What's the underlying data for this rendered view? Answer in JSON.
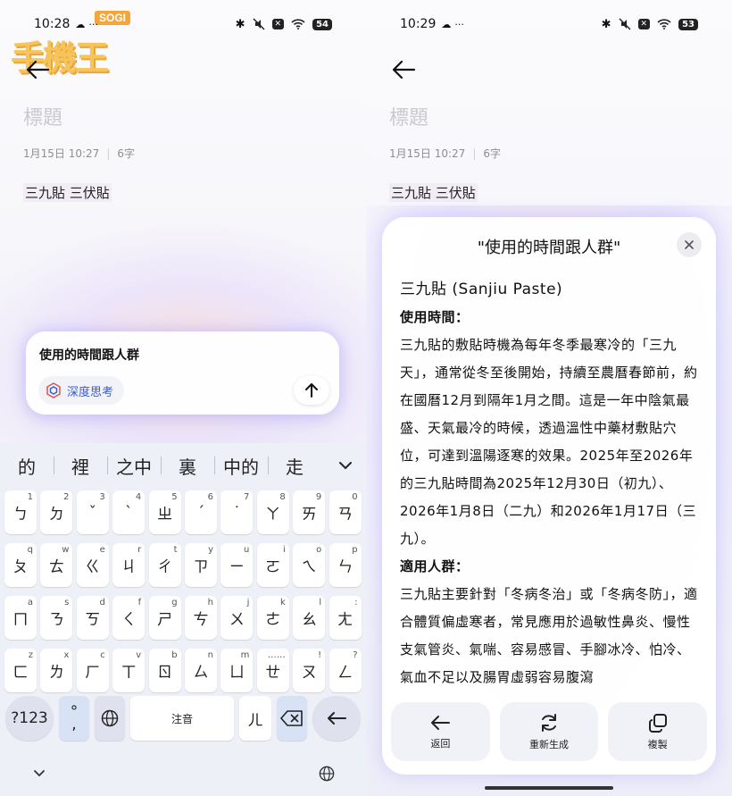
{
  "left": {
    "status": {
      "time": "10:28",
      "cloud": "☁",
      "dots": "···",
      "bluetooth": "✱",
      "x_badge": "✕",
      "wifi": "◠",
      "battery": "54"
    },
    "watermark": {
      "brand": "SOGI",
      "mark": "手機王"
    },
    "note": {
      "title_placeholder": "標題",
      "date": "1月15日 10:27",
      "separator": "|",
      "word_count": "6字",
      "body": "三九貼 三伏貼"
    },
    "prompt": {
      "text": "使用的時間跟人群",
      "chip_label": "深度思考"
    },
    "keyboard": {
      "candidates": [
        "的",
        "裡",
        "之中",
        "裏",
        "中的",
        "走"
      ],
      "row1": [
        {
          "main": "ㄅ",
          "sup": "1"
        },
        {
          "main": "ㄉ",
          "sup": "2"
        },
        {
          "main": "ˇ",
          "sup": "3"
        },
        {
          "main": "ˋ",
          "sup": "4"
        },
        {
          "main": "ㄓ",
          "sup": "5"
        },
        {
          "main": "ˊ",
          "sup": "6"
        },
        {
          "main": "˙",
          "sup": "7"
        },
        {
          "main": "ㄚ",
          "sup": "8"
        },
        {
          "main": "ㄞ",
          "sup": "9"
        },
        {
          "main": "ㄢ",
          "sup": "0"
        }
      ],
      "row2": [
        {
          "main": "ㄆ",
          "sup": "q"
        },
        {
          "main": "ㄊ",
          "sup": "w"
        },
        {
          "main": "ㄍ",
          "sup": "e"
        },
        {
          "main": "ㄐ",
          "sup": "r"
        },
        {
          "main": "ㄔ",
          "sup": "t"
        },
        {
          "main": "ㄗ",
          "sup": "y"
        },
        {
          "main": "ㄧ",
          "sup": "u"
        },
        {
          "main": "ㄛ",
          "sup": "i"
        },
        {
          "main": "ㄟ",
          "sup": "o"
        },
        {
          "main": "ㄣ",
          "sup": "p"
        }
      ],
      "row3": [
        {
          "main": "ㄇ",
          "sup": "a"
        },
        {
          "main": "ㄋ",
          "sup": "s"
        },
        {
          "main": "ㄎ",
          "sup": "d"
        },
        {
          "main": "ㄑ",
          "sup": "f"
        },
        {
          "main": "ㄕ",
          "sup": "g"
        },
        {
          "main": "ㄘ",
          "sup": "h"
        },
        {
          "main": "ㄨ",
          "sup": "j"
        },
        {
          "main": "ㄜ",
          "sup": "k"
        },
        {
          "main": "ㄠ",
          "sup": "l"
        },
        {
          "main": "ㄤ",
          "sup": ":"
        }
      ],
      "row4": [
        {
          "main": "ㄈ",
          "sup": "z"
        },
        {
          "main": "ㄌ",
          "sup": "x"
        },
        {
          "main": "ㄏ",
          "sup": "c"
        },
        {
          "main": "ㄒ",
          "sup": "v"
        },
        {
          "main": "ㄖ",
          "sup": "b"
        },
        {
          "main": "ㄙ",
          "sup": "n"
        },
        {
          "main": "ㄩ",
          "sup": "m"
        },
        {
          "main": "ㄝ",
          "sup": "……"
        },
        {
          "main": "ㄡ",
          "sup": "!"
        },
        {
          "main": "ㄥ",
          "sup": "?"
        }
      ],
      "bottom": {
        "num_label": "?123",
        "punct_top": "°",
        "punct_bottom": ",",
        "space_label": "注音",
        "er_label": "ㄦ"
      }
    }
  },
  "right": {
    "status": {
      "time": "10:29",
      "cloud": "☁",
      "dots": "···",
      "bluetooth": "✱",
      "x_badge": "✕",
      "wifi": "◠",
      "battery": "53"
    },
    "note": {
      "title_placeholder": "標題",
      "date": "1月15日 10:27",
      "separator": "|",
      "word_count": "6字",
      "body": "三九貼 三伏貼"
    },
    "sheet": {
      "title": "\"使用的時間跟人群\"",
      "heading": "三九貼 (Sanjiu Paste)",
      "section1_label": "使用時間：",
      "section1_text": "三九貼的敷貼時機為每年冬季最寒冷的「三九天」，通常從冬至後開始，持續至農曆春節前，約在國曆12月到隔年1月之間。這是一年中陰氣最盛、天氣最冷的時候，透過溫性中藥材敷貼穴位，可達到溫陽逐寒的效果。2025年至2026年的三九貼時間為2025年12月30日（初九）、2026年1月8日（二九）和2026年1月17日（三九）。",
      "section2_label": "適用人群：",
      "section2_text": "三九貼主要針對「冬病冬治」或「冬病冬防」，適合體質偏虛寒者，常見應用於過敏性鼻炎、慢性支氣管炎、氣喘、容易感冒、手腳冰冷、怕冷、氣血不足以及腸胃虛弱容易腹瀉",
      "actions": {
        "back": "返回",
        "regenerate": "重新生成",
        "copy": "複製"
      }
    }
  }
}
